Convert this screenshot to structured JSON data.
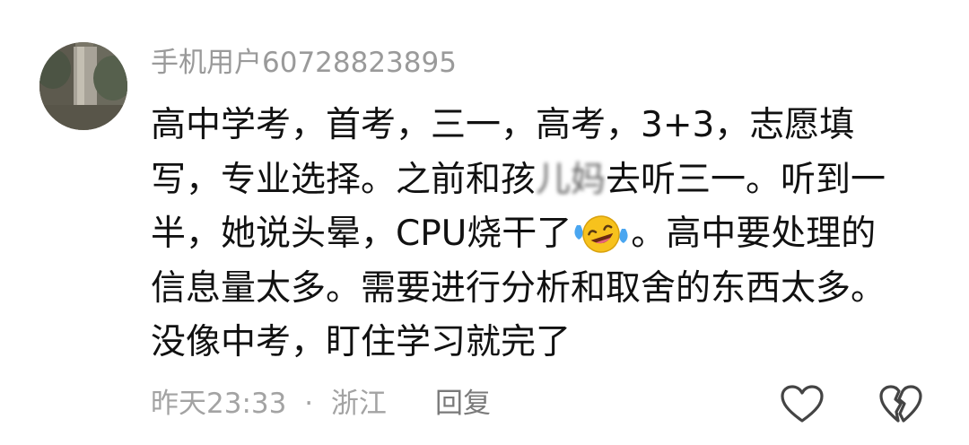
{
  "comment": {
    "username": "手机用户60728823895",
    "body": {
      "line1": "高中学考，首考，三一，高考，3+3，志愿填",
      "line2_a": "写，专业选择。之前和孩",
      "line2_blur": "儿妈",
      "line2_b": "去听三一。听到一",
      "line3_a": "半，她说头晕，CPU烧干了",
      "line3_b": "。高中要处理的",
      "line4": "信息量太多。需要进行分析和取舍的东西太多。",
      "line5": "没像中考，盯住学习就完了"
    },
    "emoji": "laughing-with-tears",
    "time": "昨天23:33",
    "separator": "·",
    "location": "浙江",
    "reply_label": "回复",
    "icons": {
      "like": "heart-outline-icon",
      "dislike": "broken-heart-outline-icon"
    },
    "colors": {
      "text": "#111111",
      "muted": "#9a9a9a",
      "icon": "#444444"
    }
  }
}
